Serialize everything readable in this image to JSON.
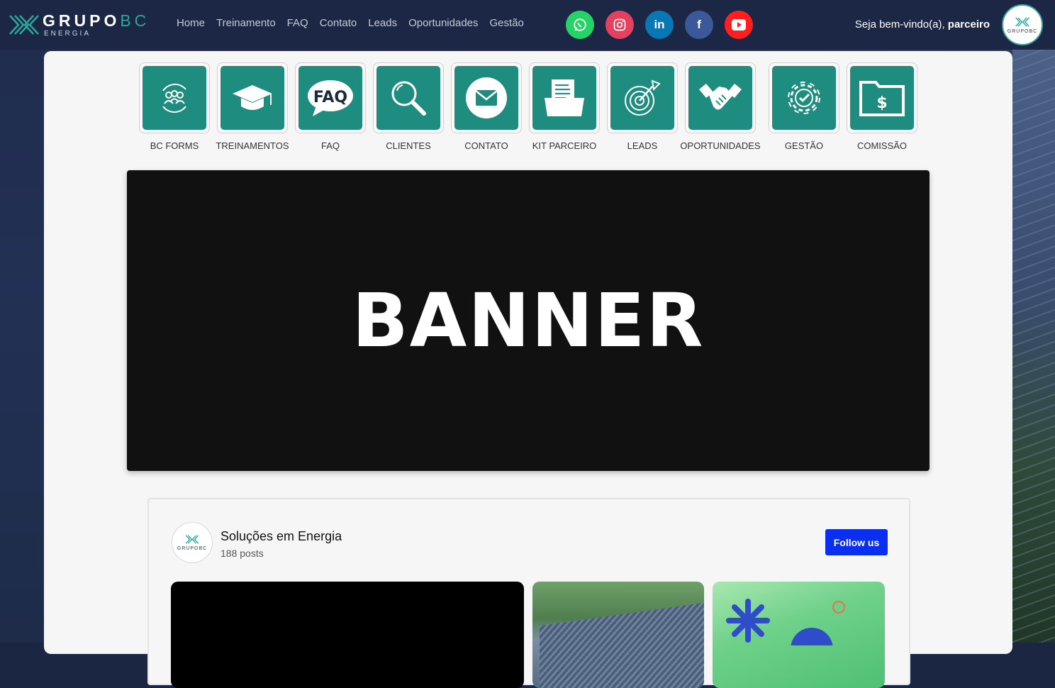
{
  "logo": {
    "brand_main": "GRUPO",
    "brand_accent": "BC",
    "sub": "ENERGIA"
  },
  "nav": [
    "Home",
    "Treinamento",
    "FAQ",
    "Contato",
    "Leads",
    "Oportunidades",
    "Gestão"
  ],
  "social": [
    {
      "name": "whatsapp",
      "color": "#25d366",
      "glyph": "✆"
    },
    {
      "name": "instagram",
      "color": "#e4405f",
      "glyph": "◎"
    },
    {
      "name": "linkedin",
      "color": "#0a77b5",
      "glyph": "in"
    },
    {
      "name": "facebook",
      "color": "#3b5998",
      "glyph": "f"
    },
    {
      "name": "youtube",
      "color": "#ff1f1f",
      "glyph": "▶"
    }
  ],
  "welcome": {
    "prefix": "Seja bem-vindo(a), ",
    "user": "parceiro"
  },
  "avatar": {
    "text": "GRUPOBC"
  },
  "tiles": [
    {
      "label": "BC FORMS",
      "icon": "team-cycle-icon"
    },
    {
      "label": "TREINAMENTOS",
      "icon": "graduation-cap-icon"
    },
    {
      "label": "FAQ",
      "icon": "faq-bubble-icon"
    },
    {
      "label": "CLIENTES",
      "icon": "magnifier-icon"
    },
    {
      "label": "CONTATO",
      "icon": "envelope-icon"
    },
    {
      "label": "KIT PARCEIRO",
      "icon": "document-folder-icon"
    },
    {
      "label": "LEADS",
      "icon": "target-icon"
    },
    {
      "label": "OPORTUNIDADES",
      "icon": "handshake-icon"
    },
    {
      "label": "GESTÃO",
      "icon": "gear-check-icon"
    },
    {
      "label": "COMISSÃO",
      "icon": "money-folder-icon"
    }
  ],
  "banner": {
    "text": "BANNER"
  },
  "feed": {
    "title": "Soluções em Energia",
    "posts": "188 posts",
    "follow_label": "Follow us"
  },
  "colors": {
    "tile": "#1e8c7f",
    "topbar": "#1c2745",
    "follow": "#0a2ff0"
  }
}
